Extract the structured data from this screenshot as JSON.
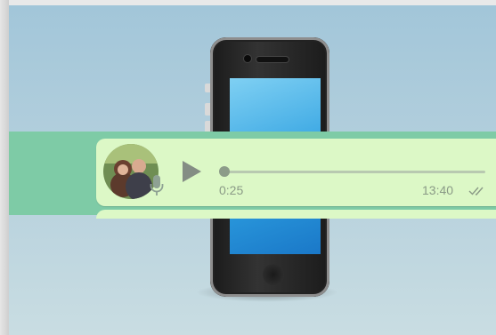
{
  "voice_message": {
    "duration": "0:25",
    "timestamp": "13:40",
    "progress_fraction": 0,
    "status": "double-tick-delivered",
    "icons": {
      "play": "play-icon",
      "mic": "microphone-icon",
      "status": "double-check-icon"
    }
  },
  "colors": {
    "bubble": "#dcf8c6",
    "highlight": "#7ecba6",
    "meta_text": "#8a9a86"
  }
}
